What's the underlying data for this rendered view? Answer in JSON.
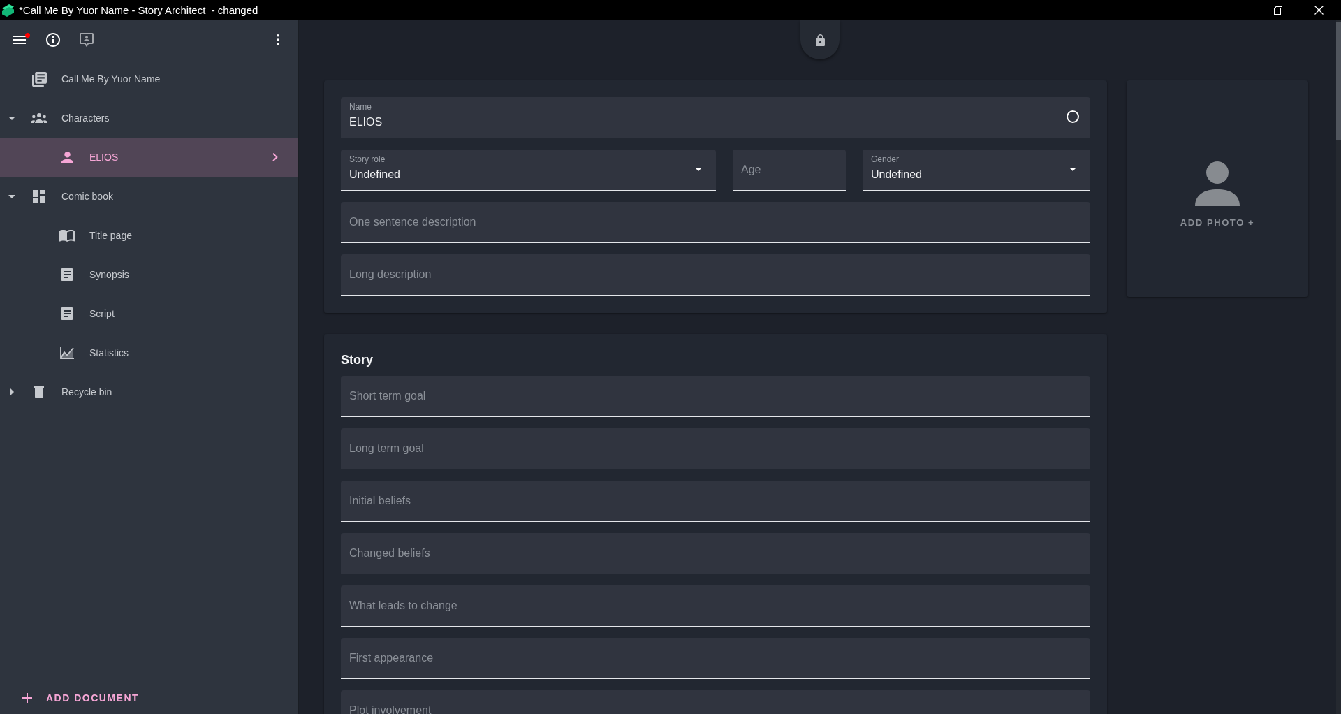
{
  "window": {
    "title": "*Call Me By Yuor Name - Story Architect  - changed"
  },
  "sidebar": {
    "toolbar": {
      "menu_badge": true
    },
    "tree": [
      {
        "kind": "project",
        "label": "Call Me By Yuor Name",
        "selected": false
      },
      {
        "kind": "characters",
        "label": "Characters",
        "selected": false,
        "expanded": true,
        "children": [
          {
            "kind": "character",
            "label": "ELIOS",
            "selected": true
          }
        ]
      },
      {
        "kind": "comic_book",
        "label": "Comic book",
        "selected": false,
        "expanded": true,
        "children": [
          {
            "kind": "title_page",
            "label": "Title page",
            "selected": false
          },
          {
            "kind": "text_document",
            "label": "Synopsis",
            "selected": false
          },
          {
            "kind": "text_document",
            "label": "Script",
            "selected": false
          },
          {
            "kind": "statistics",
            "label": "Statistics",
            "selected": false
          }
        ]
      },
      {
        "kind": "recycle_bin",
        "label": "Recycle bin",
        "selected": false,
        "expanded": false
      }
    ],
    "add_button": {
      "label": "ADD DOCUMENT"
    }
  },
  "character_card": {
    "rows": [
      [
        {
          "kind": "name",
          "label": "Name",
          "value": "ELIOS"
        }
      ],
      [
        {
          "kind": "dropdown",
          "label": "Story role",
          "value": "Undefined"
        },
        {
          "kind": "text",
          "placeholder": "Age"
        },
        {
          "kind": "dropdown",
          "label": "Gender",
          "value": "Undefined"
        }
      ],
      [
        {
          "kind": "text",
          "placeholder": "One sentence description"
        }
      ],
      [
        {
          "kind": "text",
          "placeholder": "Long description"
        }
      ]
    ]
  },
  "photo_card": {
    "label": "ADD PHOTO +"
  },
  "story_card": {
    "title": "Story",
    "fields": [
      {
        "placeholder": "Short term goal"
      },
      {
        "placeholder": "Long term goal"
      },
      {
        "placeholder": "Initial beliefs"
      },
      {
        "placeholder": "Changed beliefs"
      },
      {
        "placeholder": "What leads to change"
      },
      {
        "placeholder": "First appearance"
      },
      {
        "placeholder": "Plot involvement"
      }
    ]
  }
}
